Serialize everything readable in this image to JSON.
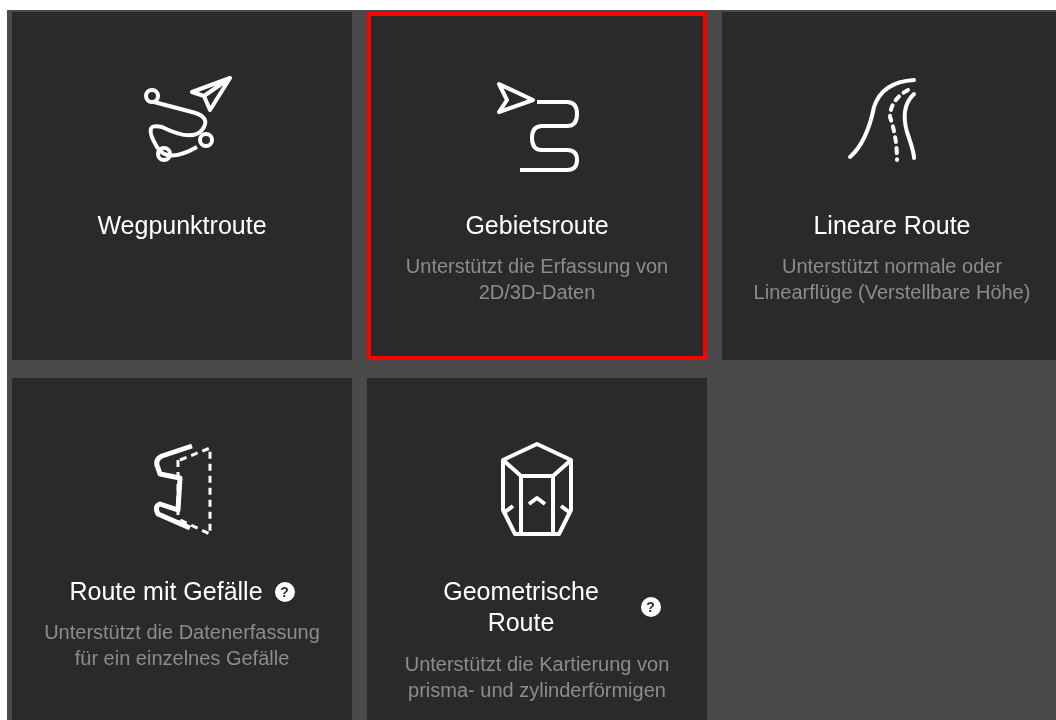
{
  "route_types": [
    {
      "kind": "waypoint",
      "title": "Wegpunktroute",
      "selected": false
    },
    {
      "kind": "area",
      "title": "Gebietsroute",
      "description": "Unterstützt die Erfassung von 2D/3D-Daten",
      "selected": true
    },
    {
      "kind": "linear",
      "title": "Lineare Route",
      "description": "Unterstützt normale oder Linearflüge (Verstellbare Höhe)",
      "selected": false
    },
    {
      "kind": "slope",
      "title": "Route mit Gefälle",
      "help": "?",
      "description": "Unterstützt die Datenerfassung für ein einzelnes Gefälle",
      "selected": false
    },
    {
      "kind": "geometric",
      "title": "Geometrische Route",
      "help": "?",
      "description": "Unterstützt die Kartierung von prisma- und zylinderförmigen",
      "selected": false
    }
  ]
}
